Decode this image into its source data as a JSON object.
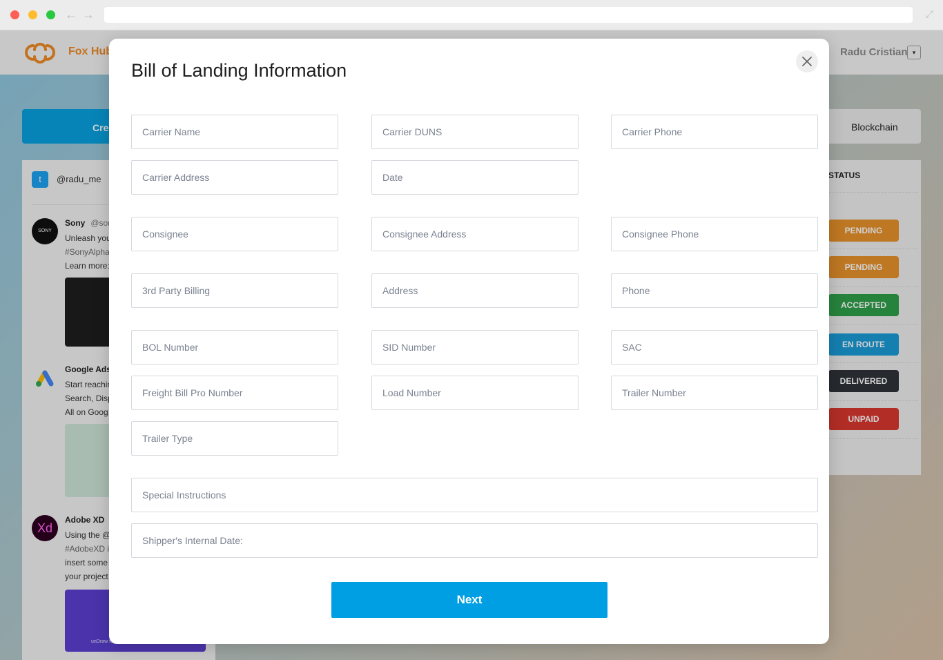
{
  "browser": {
    "back_icon": "←",
    "forward_icon": "→",
    "expand_icon": "⤢"
  },
  "header": {
    "brand": "Fox Hub",
    "user_name": "Radu Cristian",
    "user_menu_icon": "▾"
  },
  "actions": {
    "create_label": "Crea",
    "blockchain_label": "Blockchain"
  },
  "feed": {
    "handle": "@radu_me",
    "tweets": [
      {
        "name": "Sony",
        "handle": "@sor",
        "avatar_text": "SONY",
        "lines": [
          "Unleash you",
          "#SonyAlpha",
          "Learn more:"
        ]
      },
      {
        "name": "Google Ads",
        "handle": "",
        "avatar_text": "",
        "lines": [
          "Start reachir",
          "Search, Disp",
          "All on Goog"
        ]
      },
      {
        "name": "Adobe XD",
        "handle": "",
        "avatar_text": "Xd",
        "lines": [
          "Using the @",
          "#AdobeXD i",
          "insert some",
          "your project"
        ]
      }
    ],
    "media_caption": "unDraw for"
  },
  "status_panel": {
    "header": "STATUS",
    "badges": [
      {
        "label": "PENDING",
        "color": "#e8922a"
      },
      {
        "label": "PENDING",
        "color": "#e8922a"
      },
      {
        "label": "ACCEPTED",
        "color": "#2fa04a"
      },
      {
        "label": "EN ROUTE",
        "color": "#1a9bd7"
      },
      {
        "label": "DELIVERED",
        "color": "#2f3439"
      },
      {
        "label": "UNPAID",
        "color": "#d9372f"
      }
    ]
  },
  "modal": {
    "title": "Bill of Landing Information",
    "close_icon": "close-icon",
    "fields": {
      "carrier_name": {
        "placeholder": "Carrier Name",
        "value": ""
      },
      "carrier_duns": {
        "placeholder": "Carrier DUNS",
        "value": ""
      },
      "carrier_phone": {
        "placeholder": "Carrier Phone",
        "value": ""
      },
      "carrier_address": {
        "placeholder": "Carrier Address",
        "value": ""
      },
      "date": {
        "placeholder": "Date",
        "value": ""
      },
      "consignee": {
        "placeholder": "Consignee",
        "value": ""
      },
      "consignee_address": {
        "placeholder": "Consignee Address",
        "value": ""
      },
      "consignee_phone": {
        "placeholder": "Consignee Phone",
        "value": ""
      },
      "third_party_billing": {
        "placeholder": "3rd Party Billing",
        "value": ""
      },
      "address": {
        "placeholder": "Address",
        "value": ""
      },
      "phone": {
        "placeholder": "Phone",
        "value": ""
      },
      "bol_number": {
        "placeholder": "BOL Number",
        "value": ""
      },
      "sid_number": {
        "placeholder": "SID Number",
        "value": ""
      },
      "sac": {
        "placeholder": "SAC",
        "value": ""
      },
      "freight_bill_pro_number": {
        "placeholder": "Freight Bill Pro Number",
        "value": ""
      },
      "load_number": {
        "placeholder": "Load Number",
        "value": ""
      },
      "trailer_number": {
        "placeholder": "Trailer Number",
        "value": ""
      },
      "trailer_type": {
        "placeholder": "Trailer Type",
        "value": ""
      },
      "special_instructions": {
        "placeholder": "Special Instructions",
        "value": ""
      },
      "shippers_internal_date": {
        "placeholder": "Shipper's Internal Date:",
        "value": ""
      }
    },
    "next_label": "Next"
  }
}
